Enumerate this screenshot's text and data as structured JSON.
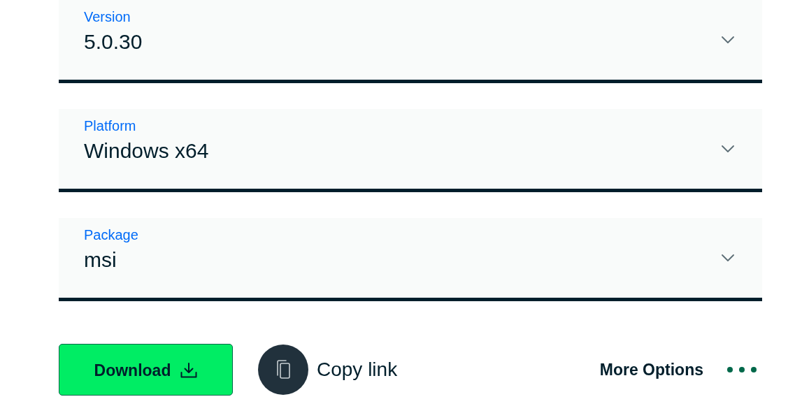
{
  "selects": [
    {
      "label": "Version",
      "value": "5.0.30"
    },
    {
      "label": "Platform",
      "value": "Windows x64"
    },
    {
      "label": "Package",
      "value": "msi"
    }
  ],
  "actions": [
    {
      "kind": "download",
      "label": "Download"
    },
    {
      "kind": "copy",
      "label": "Copy link"
    },
    {
      "kind": "more",
      "label": "More Options"
    }
  ]
}
